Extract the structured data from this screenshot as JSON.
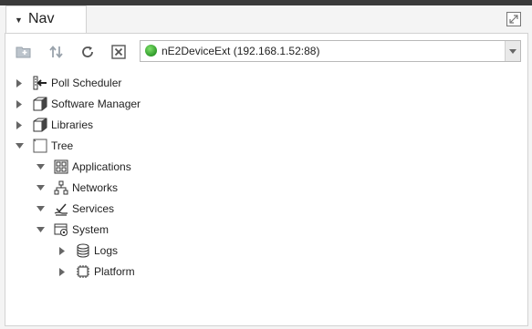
{
  "tab": {
    "title": "Nav"
  },
  "toolbar": {
    "buttons": [
      "new-folder",
      "sort",
      "refresh",
      "close"
    ],
    "device_select": {
      "value": "nE2DeviceExt (192.168.1.52:88)",
      "status_color": "#3aa635"
    }
  },
  "tree": [
    {
      "label": "Poll Scheduler",
      "icon": "poll-scheduler-icon",
      "expanded": false
    },
    {
      "label": "Software Manager",
      "icon": "cube-icon",
      "expanded": false
    },
    {
      "label": "Libraries",
      "icon": "cube-icon",
      "expanded": false
    },
    {
      "label": "Tree",
      "icon": "folder-outline-icon",
      "expanded": true
    },
    {
      "label": "Applications",
      "icon": "applications-icon",
      "expanded": true
    },
    {
      "label": "Networks",
      "icon": "network-icon",
      "expanded": true
    },
    {
      "label": "Services",
      "icon": "services-icon",
      "expanded": true
    },
    {
      "label": "System",
      "icon": "system-icon",
      "expanded": true
    },
    {
      "label": "Logs",
      "icon": "database-icon",
      "expanded": false
    },
    {
      "label": "Platform",
      "icon": "chip-icon",
      "expanded": false
    }
  ]
}
